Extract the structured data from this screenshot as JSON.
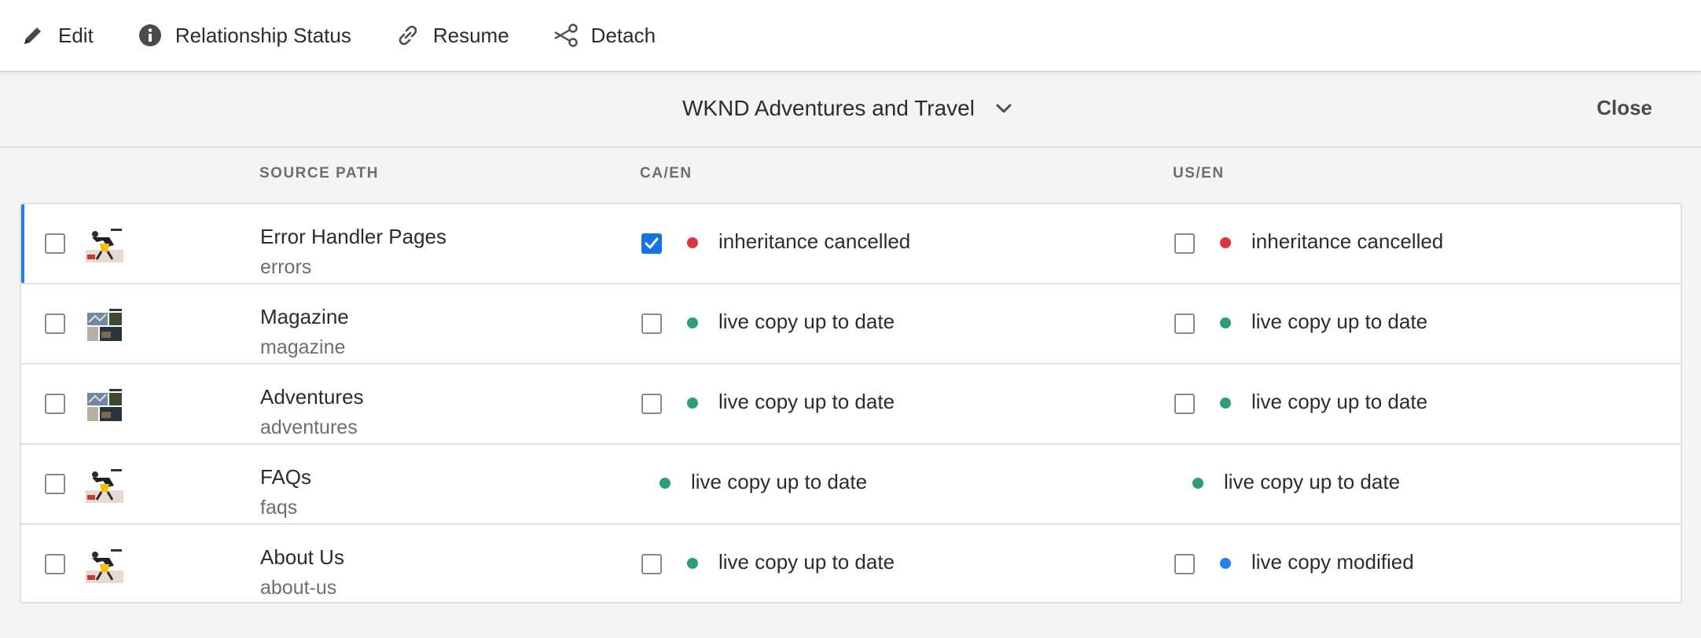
{
  "toolbar": {
    "edit": "Edit",
    "relationship_status": "Relationship Status",
    "resume": "Resume",
    "detach": "Detach"
  },
  "header": {
    "site": "WKND Adventures and Travel",
    "close": "Close"
  },
  "columns": {
    "source_path": "SOURCE PATH",
    "ca_en": "CA/EN",
    "us_en": "US/EN"
  },
  "colors": {
    "cancelled": "#d7373f",
    "up_to_date": "#2d9d78",
    "modified": "#2680eb",
    "accent": "#1473e6"
  },
  "rows": [
    {
      "name": "Error Handler Pages",
      "path": "errors",
      "selected": true,
      "ca": {
        "status": "inheritance cancelled",
        "state": "cancelled",
        "checkbox": true,
        "checked": true
      },
      "us": {
        "status": "inheritance cancelled",
        "state": "cancelled",
        "checkbox": true,
        "checked": false
      }
    },
    {
      "name": "Magazine",
      "path": "magazine",
      "ca": {
        "status": "live copy up to date",
        "state": "up_to_date",
        "checkbox": true,
        "checked": false
      },
      "us": {
        "status": "live copy up to date",
        "state": "up_to_date",
        "checkbox": true,
        "checked": false
      }
    },
    {
      "name": "Adventures",
      "path": "adventures",
      "ca": {
        "status": "live copy up to date",
        "state": "up_to_date",
        "checkbox": true,
        "checked": false
      },
      "us": {
        "status": "live copy up to date",
        "state": "up_to_date",
        "checkbox": true,
        "checked": false
      }
    },
    {
      "name": "FAQs",
      "path": "faqs",
      "ca": {
        "status": "live copy up to date",
        "state": "up_to_date",
        "checkbox": false,
        "checked": false
      },
      "us": {
        "status": "live copy up to date",
        "state": "up_to_date",
        "checkbox": false,
        "checked": false
      }
    },
    {
      "name": "About Us",
      "path": "about-us",
      "ca": {
        "status": "live copy up to date",
        "state": "up_to_date",
        "checkbox": true,
        "checked": false
      },
      "us": {
        "status": "live copy modified",
        "state": "modified",
        "checkbox": true,
        "checked": false
      }
    }
  ]
}
